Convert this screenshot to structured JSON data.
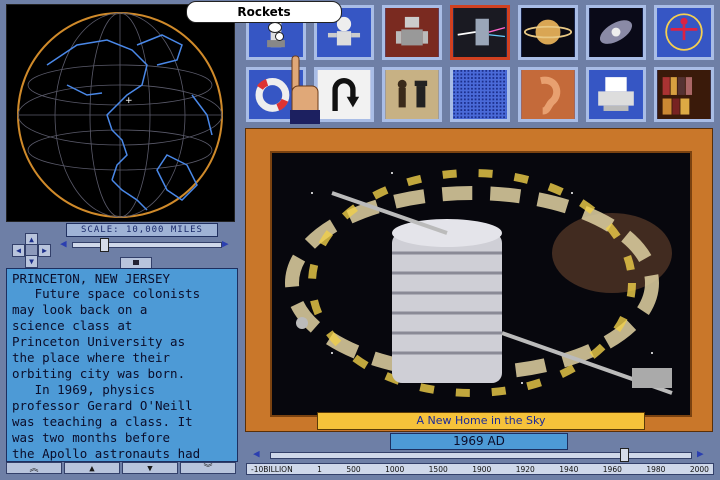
{
  "tooltip": {
    "label": "Rockets"
  },
  "globe": {
    "scale_label": "SCALE: 10,000 MILES"
  },
  "nav_icons": {
    "up": "▲",
    "down": "▼",
    "left": "◀",
    "right": "▶",
    "slider_left": "◀",
    "slider_right": "▶"
  },
  "article": {
    "place": "PRINCETON, NEW JERSEY",
    "body": "   Future space colonists\nmay look back on a\nscience class at\nPrinceton University as\nthe place where their\norbiting city was born.\n   In 1969, physics\nprofessor Gerard O'Neill\nwas teaching a class. It\nwas two months before\nthe Apollo astronauts had"
  },
  "text_nav": [
    "︽",
    "▲",
    "▼",
    "︾"
  ],
  "topic_tiles": [
    {
      "name": "rockets-icon"
    },
    {
      "name": "astronaut-icon"
    },
    {
      "name": "robot-icon"
    },
    {
      "name": "prism-icon",
      "selected": true
    },
    {
      "name": "saturn-icon"
    },
    {
      "name": "galaxy-icon"
    },
    {
      "name": "human-figure-icon"
    },
    {
      "name": "lifebuoy-icon"
    },
    {
      "name": "u-turn-icon"
    },
    {
      "name": "chess-icon"
    },
    {
      "name": "grid-icon"
    },
    {
      "name": "ear-icon"
    },
    {
      "name": "printer-icon"
    },
    {
      "name": "bookshelf-icon"
    }
  ],
  "picture": {
    "caption": "A New Home in the Sky"
  },
  "timeline": {
    "current": "1969 AD",
    "position": 0.84,
    "ticks": [
      "-10BILLION",
      "1",
      "500",
      "1000",
      "1500",
      "1900",
      "1920",
      "1940",
      "1960",
      "1980",
      "2000"
    ]
  },
  "colors": {
    "accent": "#3c63d0",
    "frame": "#c9772a",
    "panel": "#4d9ad6",
    "background": "#6e7fa6"
  }
}
